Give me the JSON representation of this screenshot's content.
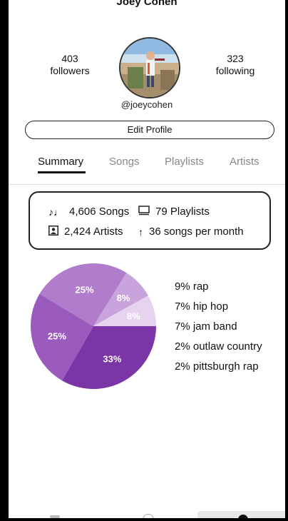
{
  "profile": {
    "name": "Joey Cohen",
    "handle": "@joeycohen",
    "followers_count": "403",
    "followers_label": "followers",
    "following_count": "323",
    "following_label": "following",
    "edit_label": "Edit Profile"
  },
  "tabs": [
    {
      "label": "Summary",
      "active": true
    },
    {
      "label": "Songs",
      "active": false
    },
    {
      "label": "Playlists",
      "active": false
    },
    {
      "label": "Artists",
      "active": false
    }
  ],
  "stats": {
    "songs": "4,606 Songs",
    "playlists": "79 Playlists",
    "artists": "2,424 Artists",
    "rate": "36 songs per month",
    "icons": [
      "music-notes-icon",
      "playlist-icon",
      "artist-icon",
      "arrow-up-icon"
    ]
  },
  "chart_data": {
    "type": "pie",
    "slice_labels": [
      "33%",
      "25%",
      "25%",
      "8%",
      "8%"
    ],
    "values": [
      33,
      25,
      25,
      8,
      8
    ],
    "colors": [
      "#7b35a6",
      "#9b5bbd",
      "#b07ccb",
      "#c9a4dc",
      "#e6d4ef"
    ],
    "legend": [
      "9% rap",
      "7% hip hop",
      "7% jam band",
      "2% outlaw country",
      "2% pittsburgh rap"
    ]
  }
}
